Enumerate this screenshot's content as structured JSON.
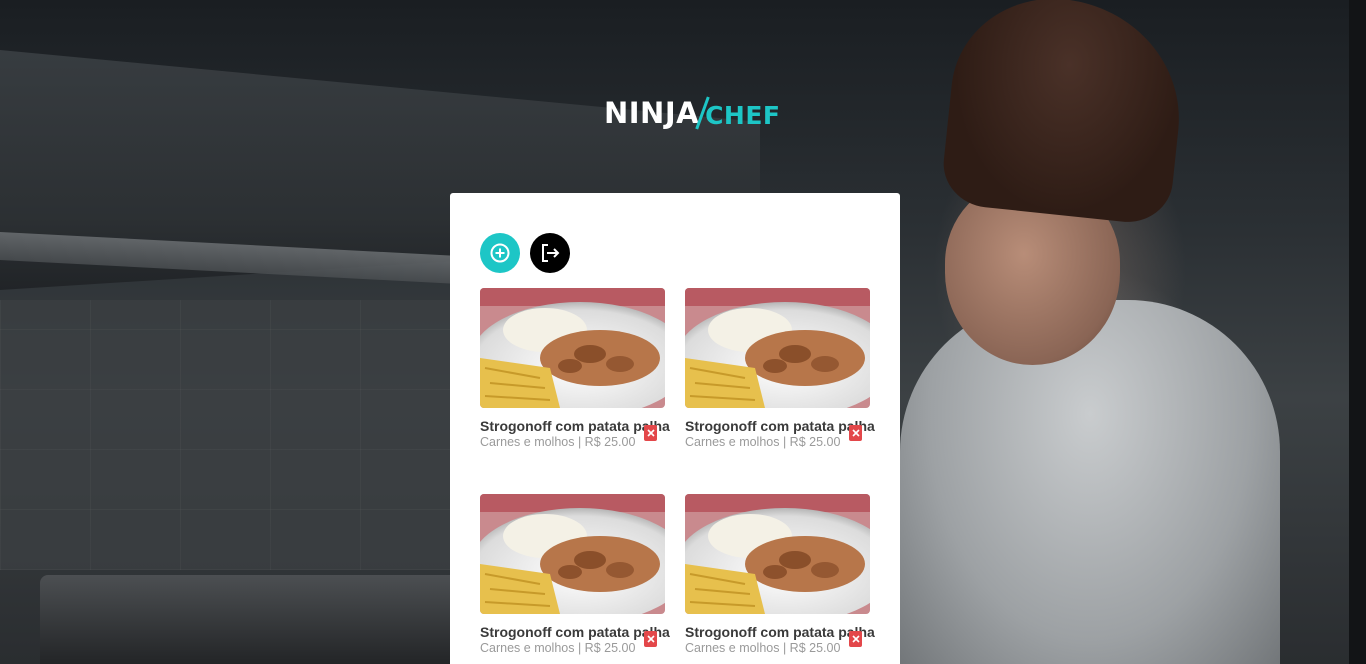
{
  "brand": {
    "name_part1": "NINJA",
    "name_part2": "CHEF",
    "accent_color": "#1dc6c6"
  },
  "actions": {
    "add_icon": "plus-circle-icon",
    "logout_icon": "logout-icon"
  },
  "menu_items": [
    {
      "title": "Strogonoff com patata palha",
      "category": "Carnes e molhos",
      "price": "R$ 25.00",
      "meta": "Carnes e molhos | R$ 25.00"
    },
    {
      "title": "Strogonoff com patata palha",
      "category": "Carnes e molhos",
      "price": "R$ 25.00",
      "meta": "Carnes e molhos | R$ 25.00"
    },
    {
      "title": "Strogonoff com patata palha",
      "category": "Carnes e molhos",
      "price": "R$ 25.00",
      "meta": "Carnes e molhos | R$ 25.00"
    },
    {
      "title": "Strogonoff com patata palha",
      "category": "Carnes e molhos",
      "price": "R$ 25.00",
      "meta": "Carnes e molhos | R$ 25.00"
    }
  ],
  "colors": {
    "delete": "#e3474a",
    "logout_button": "#000000",
    "add_button": "#1dc6c6"
  }
}
